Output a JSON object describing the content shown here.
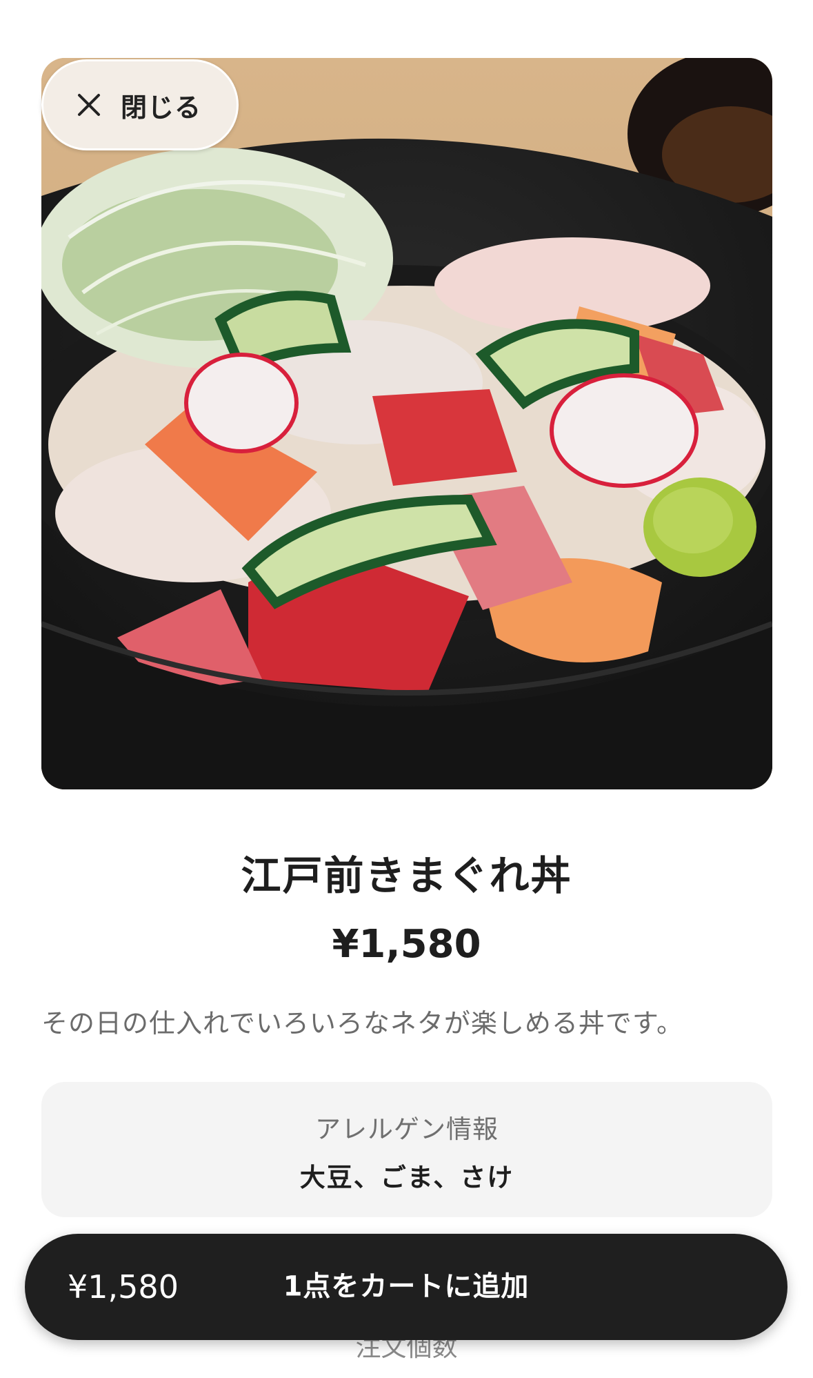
{
  "close_button": {
    "label": "閉じる",
    "icon": "close-icon"
  },
  "item": {
    "image_alt": "江戸前きまぐれ丼",
    "title": "江戸前きまぐれ丼",
    "price": "¥1,580",
    "description": "その日の仕入れでいろいろなネタが楽しめる丼です。"
  },
  "allergen": {
    "title": "アレルゲン情報",
    "value": "大豆、ごま、さけ"
  },
  "quantity_label": "注文個数",
  "cart_bar": {
    "price": "¥1,580",
    "label": "1点をカートに追加"
  },
  "colors": {
    "cart_bar": "#1f1f1f",
    "allergen_bg": "#f4f4f4",
    "close_bg": "#f3ede6"
  }
}
